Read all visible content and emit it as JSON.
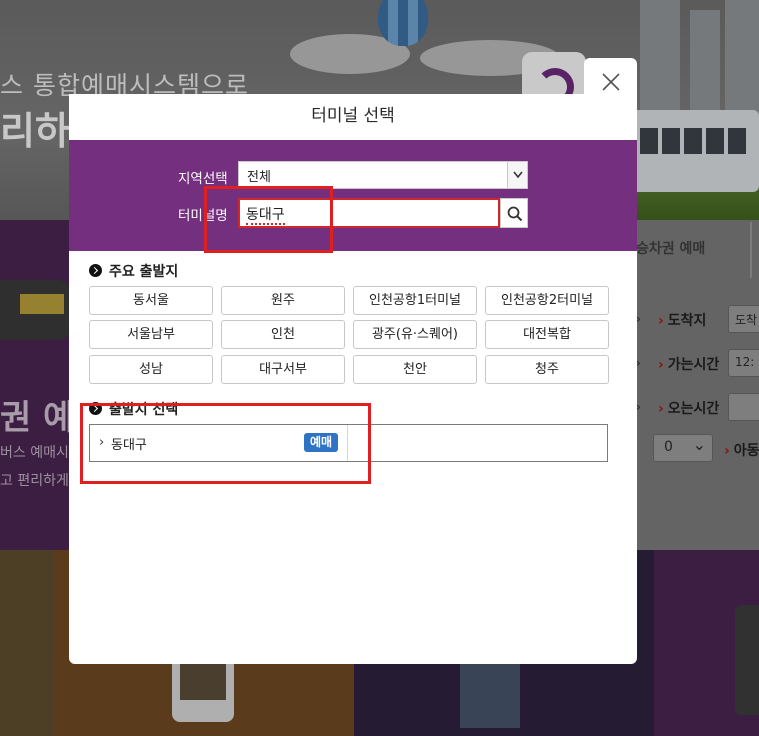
{
  "background": {
    "hero_line1": "스 통합예매시스템으로",
    "hero_line2": "리하게",
    "left_heading": "권 예",
    "left_line1": "버스 예매시",
    "left_line2": "고 편리하게",
    "tab_label": "승차권 예매",
    "rows": [
      {
        "label": "도착지",
        "box": "도착"
      },
      {
        "label": "가는시간",
        "box": "12:"
      },
      {
        "label": "오는시간",
        "box": ""
      }
    ],
    "passenger_count": "0",
    "passenger_label": "아동"
  },
  "modal": {
    "title": "터미널 선택",
    "region_label": "지역선택",
    "region_value": "전체",
    "terminal_label": "터미널명",
    "terminal_value": "동대구",
    "major_section_title": "주요 출발지",
    "major_terminals": [
      "동서울",
      "원주",
      "인천공항1터미널",
      "인천공항2터미널",
      "서울남부",
      "인천",
      "광주(유·스퀘어)",
      "대전복합",
      "성남",
      "대구서부",
      "천안",
      "청주"
    ],
    "departure_section_title": "출발지 선택",
    "results": [
      {
        "name": "동대구",
        "badge": "예매"
      }
    ]
  },
  "colors": {
    "accent_purple": "#74307e",
    "badge_blue": "#2f74c4",
    "highlight_red": "#e02020"
  }
}
